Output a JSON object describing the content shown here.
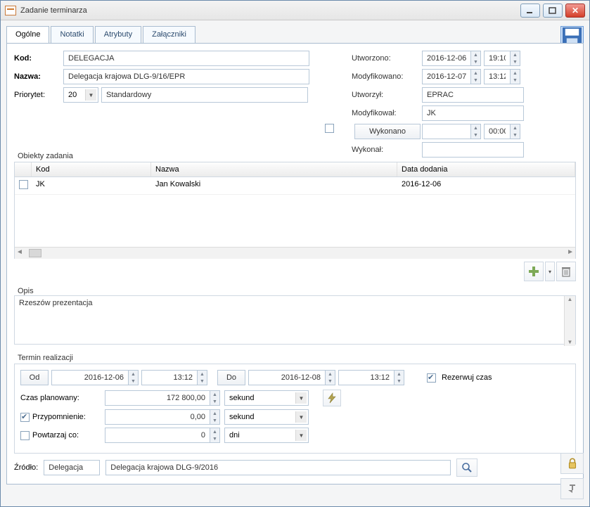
{
  "window": {
    "title": "Zadanie terminarza"
  },
  "tabs": {
    "general": "Ogólne",
    "notes": "Notatki",
    "attributes": "Atrybuty",
    "attachments": "Załączniki"
  },
  "left": {
    "kod_label": "Kod:",
    "kod_value": "DELEGACJA",
    "nazwa_label": "Nazwa:",
    "nazwa_value": "Delegacja krajowa DLG-9/16/EPR",
    "priorytet_label": "Priorytet:",
    "priorytet_value": "20",
    "priorytet_text": "Standardowy"
  },
  "right": {
    "utworzono_label": "Utworzono:",
    "utworzono_date": "2016-12-06",
    "utworzono_time": "19:10",
    "modyfikowano_label": "Modyfikowano:",
    "modyfikowano_date": "2016-12-07",
    "modyfikowano_time": "13:12",
    "utworzyl_label": "Utworzył:",
    "utworzyl_value": "EPRAC",
    "modyfikowal_label": "Modyfikował:",
    "modyfikowal_value": "JK",
    "wykonano_btn": "Wykonano",
    "wykonano_date": "",
    "wykonano_time": "00:00",
    "wykonal_label": "Wykonał:",
    "wykonal_value": ""
  },
  "objects": {
    "title": "Obiekty zadania",
    "headers": {
      "kod": "Kod",
      "nazwa": "Nazwa",
      "data": "Data dodania"
    },
    "rows": [
      {
        "kod": "JK",
        "nazwa": "Jan Kowalski",
        "data": "2016-12-06"
      }
    ]
  },
  "opis": {
    "title": "Opis",
    "text": "Rzeszów prezentacja"
  },
  "termin": {
    "title": "Termin realizacji",
    "od_label": "Od",
    "od_date": "2016-12-06",
    "od_time": "13:12",
    "do_label": "Do",
    "do_date": "2016-12-08",
    "do_time": "13:12",
    "rezerwuj_label": "Rezerwuj czas",
    "czas_label": "Czas planowany:",
    "czas_value": "172 800,00",
    "czas_unit": "sekund",
    "przyp_label": "Przypomnienie:",
    "przyp_value": "0,00",
    "przyp_unit": "sekund",
    "powt_label": "Powtarzaj co:",
    "powt_value": "0",
    "powt_unit": "dni"
  },
  "source": {
    "label": "Źródło:",
    "type": "Delegacja",
    "value": "Delegacja krajowa DLG-9/2016"
  }
}
